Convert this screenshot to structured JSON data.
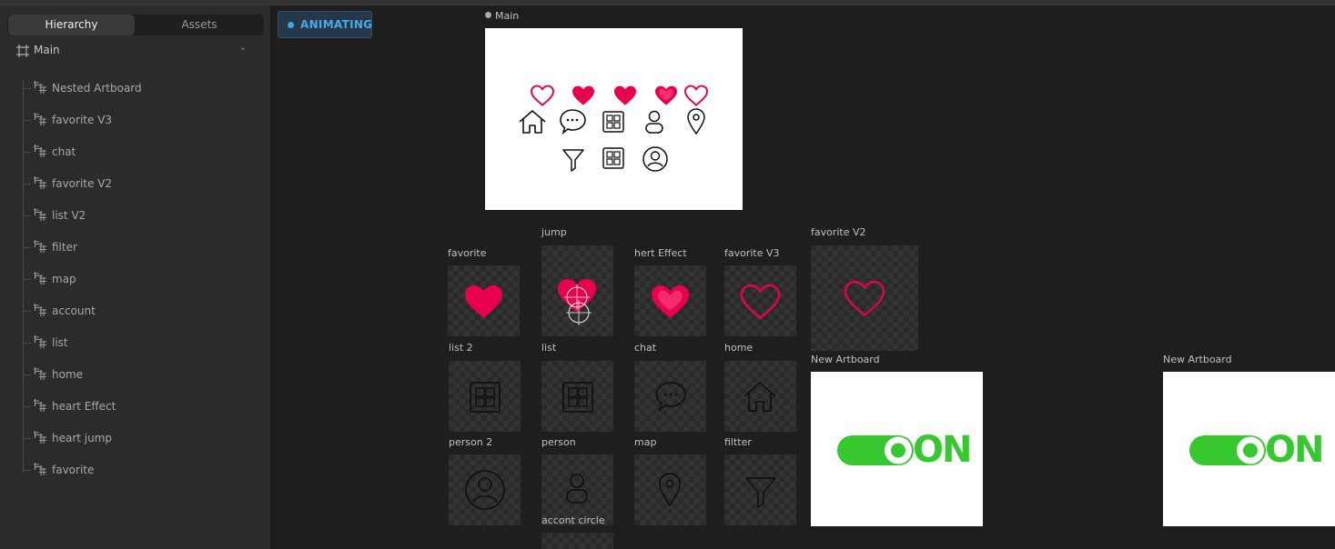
{
  "sidebar": {
    "tabs": [
      "Hierarchy",
      "Assets"
    ],
    "root": "Main",
    "items": [
      "Nested Artboard",
      "favorite V3",
      "chat",
      "favorite V2",
      "list V2",
      "filter",
      "map",
      "account",
      "list",
      "home",
      "heart Effect",
      "heart jump",
      "favorite"
    ]
  },
  "toolbar": {
    "animating_label": "ANIMATING"
  },
  "artboards": {
    "main": "Main",
    "favorite": "favorite",
    "jump": "jump",
    "hert_effect": "hert Effect",
    "favorite_v3": "favorite V3",
    "favorite_v2": "favorite V2",
    "list2": "list 2",
    "list": "list",
    "chat": "chat",
    "home": "home",
    "new_artboard_1": "New Artboard",
    "new_artboard_2": "New Artboard",
    "person2": "person 2",
    "person": "person",
    "map": "map",
    "filtter": "filtter",
    "accont_circle": "accont circle"
  },
  "toggle_text": "ON",
  "colors": {
    "heart": "#e8004c",
    "toggle": "#37c82f",
    "accent": "#3aa4ef"
  }
}
